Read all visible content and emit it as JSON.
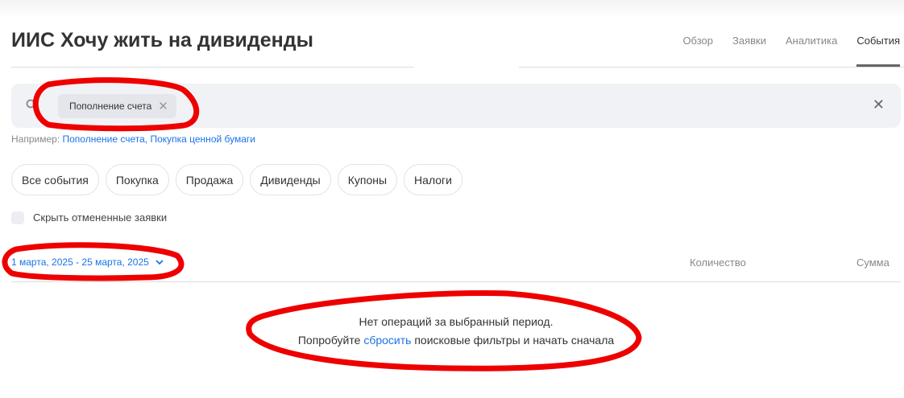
{
  "header": {
    "title": "ИИС Хочу жить на дивиденды",
    "tabs": [
      {
        "label": "Обзор"
      },
      {
        "label": "Заявки"
      },
      {
        "label": "Аналитика"
      },
      {
        "label": "События"
      }
    ]
  },
  "search": {
    "chip": "Пополнение счета",
    "hint_prefix": "Например:",
    "hint_links": "Пополнение счета, Покупка ценной бумаги"
  },
  "filters": [
    {
      "label": "Все события"
    },
    {
      "label": "Покупка"
    },
    {
      "label": "Продажа"
    },
    {
      "label": "Дивиденды"
    },
    {
      "label": "Купоны"
    },
    {
      "label": "Налоги"
    }
  ],
  "hide_cancelled": {
    "label": "Скрыть отмененные заявки",
    "checked": false
  },
  "table": {
    "date_range": "1 марта, 2025 - 25 марта, 2025",
    "col_quantity": "Количество",
    "col_sum": "Сумма"
  },
  "empty": {
    "line1": "Нет операций за выбранный период.",
    "line2_pre": "Попробуйте",
    "line2_link": "сбросить",
    "line2_post": "поисковые фильтры и начать сначала"
  },
  "colors": {
    "accent": "#1a73e8",
    "annotation": "#ee0000"
  }
}
